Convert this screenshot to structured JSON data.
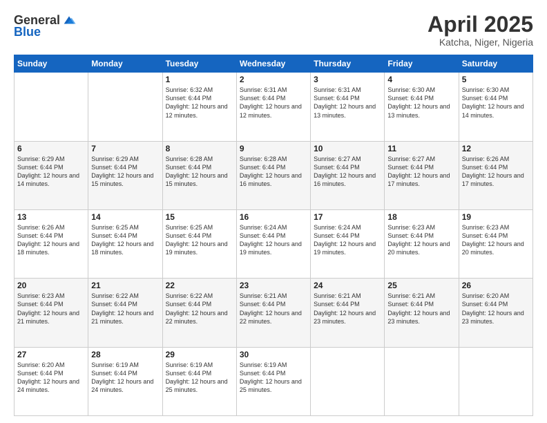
{
  "header": {
    "logo": {
      "text_general": "General",
      "text_blue": "Blue"
    },
    "title": "April 2025",
    "subtitle": "Katcha, Niger, Nigeria"
  },
  "days_of_week": [
    "Sunday",
    "Monday",
    "Tuesday",
    "Wednesday",
    "Thursday",
    "Friday",
    "Saturday"
  ],
  "weeks": [
    [
      {
        "day": "",
        "info": ""
      },
      {
        "day": "",
        "info": ""
      },
      {
        "day": "1",
        "info": "Sunrise: 6:32 AM\nSunset: 6:44 PM\nDaylight: 12 hours and 12 minutes."
      },
      {
        "day": "2",
        "info": "Sunrise: 6:31 AM\nSunset: 6:44 PM\nDaylight: 12 hours and 12 minutes."
      },
      {
        "day": "3",
        "info": "Sunrise: 6:31 AM\nSunset: 6:44 PM\nDaylight: 12 hours and 13 minutes."
      },
      {
        "day": "4",
        "info": "Sunrise: 6:30 AM\nSunset: 6:44 PM\nDaylight: 12 hours and 13 minutes."
      },
      {
        "day": "5",
        "info": "Sunrise: 6:30 AM\nSunset: 6:44 PM\nDaylight: 12 hours and 14 minutes."
      }
    ],
    [
      {
        "day": "6",
        "info": "Sunrise: 6:29 AM\nSunset: 6:44 PM\nDaylight: 12 hours and 14 minutes."
      },
      {
        "day": "7",
        "info": "Sunrise: 6:29 AM\nSunset: 6:44 PM\nDaylight: 12 hours and 15 minutes."
      },
      {
        "day": "8",
        "info": "Sunrise: 6:28 AM\nSunset: 6:44 PM\nDaylight: 12 hours and 15 minutes."
      },
      {
        "day": "9",
        "info": "Sunrise: 6:28 AM\nSunset: 6:44 PM\nDaylight: 12 hours and 16 minutes."
      },
      {
        "day": "10",
        "info": "Sunrise: 6:27 AM\nSunset: 6:44 PM\nDaylight: 12 hours and 16 minutes."
      },
      {
        "day": "11",
        "info": "Sunrise: 6:27 AM\nSunset: 6:44 PM\nDaylight: 12 hours and 17 minutes."
      },
      {
        "day": "12",
        "info": "Sunrise: 6:26 AM\nSunset: 6:44 PM\nDaylight: 12 hours and 17 minutes."
      }
    ],
    [
      {
        "day": "13",
        "info": "Sunrise: 6:26 AM\nSunset: 6:44 PM\nDaylight: 12 hours and 18 minutes."
      },
      {
        "day": "14",
        "info": "Sunrise: 6:25 AM\nSunset: 6:44 PM\nDaylight: 12 hours and 18 minutes."
      },
      {
        "day": "15",
        "info": "Sunrise: 6:25 AM\nSunset: 6:44 PM\nDaylight: 12 hours and 19 minutes."
      },
      {
        "day": "16",
        "info": "Sunrise: 6:24 AM\nSunset: 6:44 PM\nDaylight: 12 hours and 19 minutes."
      },
      {
        "day": "17",
        "info": "Sunrise: 6:24 AM\nSunset: 6:44 PM\nDaylight: 12 hours and 19 minutes."
      },
      {
        "day": "18",
        "info": "Sunrise: 6:23 AM\nSunset: 6:44 PM\nDaylight: 12 hours and 20 minutes."
      },
      {
        "day": "19",
        "info": "Sunrise: 6:23 AM\nSunset: 6:44 PM\nDaylight: 12 hours and 20 minutes."
      }
    ],
    [
      {
        "day": "20",
        "info": "Sunrise: 6:23 AM\nSunset: 6:44 PM\nDaylight: 12 hours and 21 minutes."
      },
      {
        "day": "21",
        "info": "Sunrise: 6:22 AM\nSunset: 6:44 PM\nDaylight: 12 hours and 21 minutes."
      },
      {
        "day": "22",
        "info": "Sunrise: 6:22 AM\nSunset: 6:44 PM\nDaylight: 12 hours and 22 minutes."
      },
      {
        "day": "23",
        "info": "Sunrise: 6:21 AM\nSunset: 6:44 PM\nDaylight: 12 hours and 22 minutes."
      },
      {
        "day": "24",
        "info": "Sunrise: 6:21 AM\nSunset: 6:44 PM\nDaylight: 12 hours and 23 minutes."
      },
      {
        "day": "25",
        "info": "Sunrise: 6:21 AM\nSunset: 6:44 PM\nDaylight: 12 hours and 23 minutes."
      },
      {
        "day": "26",
        "info": "Sunrise: 6:20 AM\nSunset: 6:44 PM\nDaylight: 12 hours and 23 minutes."
      }
    ],
    [
      {
        "day": "27",
        "info": "Sunrise: 6:20 AM\nSunset: 6:44 PM\nDaylight: 12 hours and 24 minutes."
      },
      {
        "day": "28",
        "info": "Sunrise: 6:19 AM\nSunset: 6:44 PM\nDaylight: 12 hours and 24 minutes."
      },
      {
        "day": "29",
        "info": "Sunrise: 6:19 AM\nSunset: 6:44 PM\nDaylight: 12 hours and 25 minutes."
      },
      {
        "day": "30",
        "info": "Sunrise: 6:19 AM\nSunset: 6:44 PM\nDaylight: 12 hours and 25 minutes."
      },
      {
        "day": "",
        "info": ""
      },
      {
        "day": "",
        "info": ""
      },
      {
        "day": "",
        "info": ""
      }
    ]
  ]
}
